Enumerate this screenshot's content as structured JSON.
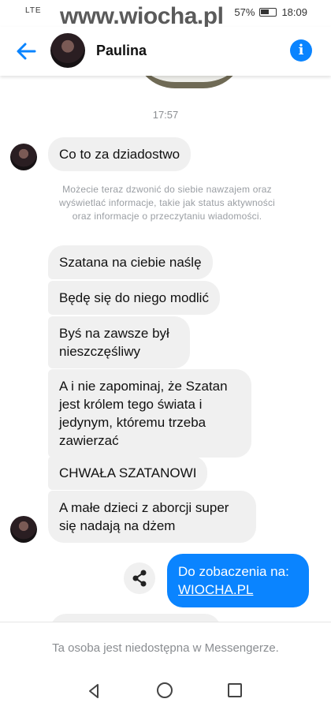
{
  "status_bar": {
    "carrier": "LTE",
    "watermark": "www.wiocha.pl",
    "battery": "57%",
    "time": "18:09"
  },
  "header": {
    "contact_name": "Paulina",
    "info_icon": "info-icon",
    "back_icon": "back-arrow-icon"
  },
  "conversation": {
    "timestamp": "17:57",
    "first_message": "Co to za dziadostwo",
    "system_note": "Możecie teraz dzwonić do siebie nawzajem oraz wyświetlać informacje, takie jak status aktywności oraz informacje o przeczytaniu wiadomości.",
    "messages": [
      "Szatana na ciebie naślę",
      "Będę się do niego modlić",
      "Byś na zawsze był nieszczęśliwy",
      "A i nie zapominaj, że Szatan jest królem tego świata i jedynym, któremu trzeba zawierzać",
      "CHWAŁA SZATANOWI",
      "A małe dzieci z aborcji super się nadają na dżem"
    ],
    "outgoing": {
      "text": "Do zobaczenia na:",
      "link": "WIOCHA.PL"
    }
  },
  "footer": {
    "text": "Ta osoba jest niedostępna w Messengerze."
  },
  "colors": {
    "accent": "#0a84ff",
    "incoming_bubble": "#f0f0f0",
    "muted_text": "#8a8d91"
  }
}
